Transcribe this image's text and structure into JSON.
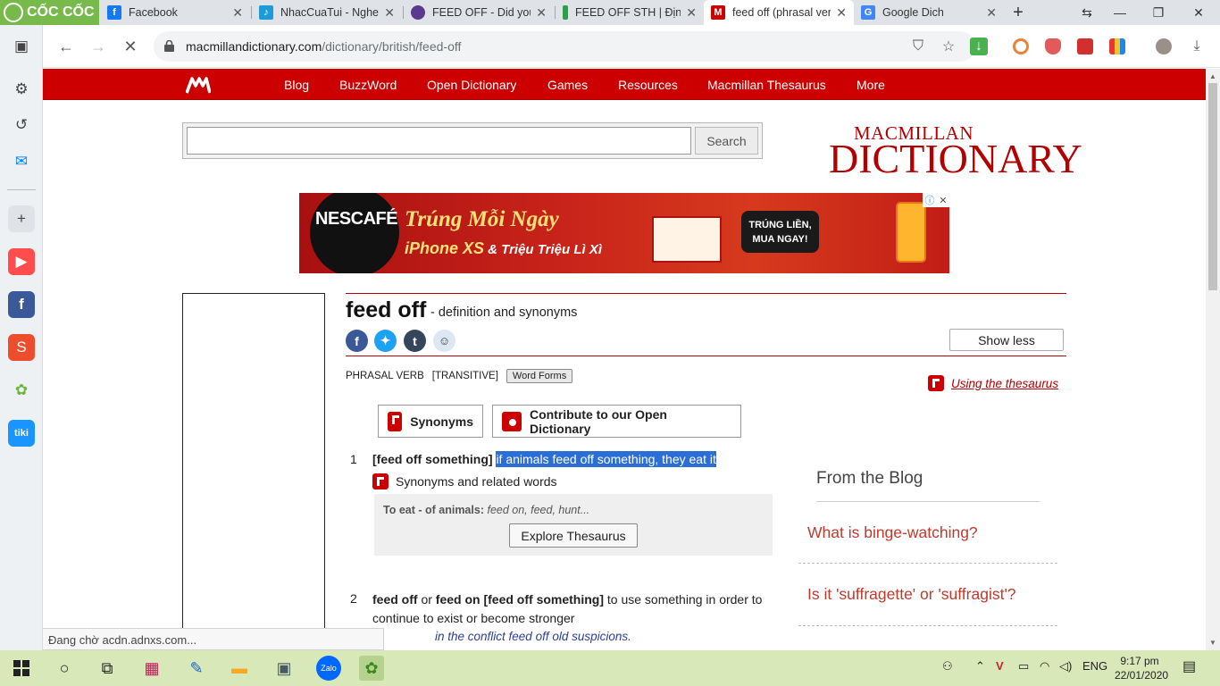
{
  "browser": {
    "brand": "CỐC CỐC",
    "tabs": [
      {
        "title": "Facebook",
        "icon": "facebook-icon",
        "color": "#1877f2",
        "glyph": "f"
      },
      {
        "title": "NhacCuaTui - Nghe n",
        "icon": "nhaccuatui-icon",
        "color": "#1e9bd7",
        "glyph": "♪"
      },
      {
        "title": "FEED OFF - Did you s",
        "icon": "dictionary-icon",
        "color": "#5b3a8e",
        "glyph": "●"
      },
      {
        "title": "FEED OFF STH | Định",
        "icon": "document-icon",
        "color": "#2d9e4d",
        "glyph": "▌"
      },
      {
        "title": "feed off (phrasal verb",
        "icon": "macmillan-icon",
        "color": "#cc0000",
        "glyph": "M"
      },
      {
        "title": "Google Dich",
        "icon": "google-translate-icon",
        "color": "#4285f4",
        "glyph": "G"
      }
    ],
    "url_domain": "macmillandictionary.com",
    "url_path": "/dictionary/british/feed-off",
    "status": "Đang chờ acdn.adnxs.com..."
  },
  "site": {
    "nav": [
      "Blog",
      "BuzzWord",
      "Open Dictionary",
      "Games",
      "Resources",
      "Macmillan Thesaurus",
      "More"
    ],
    "search_button": "Search",
    "search_placeholder": "",
    "logo_small": "MACMILLAN",
    "logo_big": "DICTIONARY"
  },
  "ad": {
    "brand": "NESCAFÉ",
    "headline": "Trúng Mỗi Ngày",
    "sub_strong": "iPhone XS",
    "sub_rest": " & Triệu Triệu Lì Xì",
    "cta_line1": "TRÚNG LIỀN,",
    "cta_line2": "MUA NGAY!"
  },
  "entry": {
    "headword": "feed off",
    "headword_suffix": "- definition and synonyms",
    "show_less": "Show less",
    "pos": "PHRASAL VERB",
    "grammar": "[TRANSITIVE]",
    "word_forms": "Word Forms",
    "thesaurus_link": "Using the thesaurus",
    "synonyms_button": "Synonyms",
    "contribute_button": "Contribute to our Open Dictionary",
    "sense1": {
      "num": "1",
      "gram": "[feed off something]",
      "def": "if animals feed off something, they eat it",
      "related_label": "Synonyms and related words",
      "syn_label": "To eat - of animals:",
      "syn_words": "feed on, feed, hunt...",
      "explore": "Explore Thesaurus"
    },
    "sense2": {
      "num": "2",
      "w1": "feed off",
      "or": " or ",
      "w2": "feed on",
      "gram": " [feed off something]",
      "def": " to use something in order to continue to exist or become stronger",
      "example": "in the conflict feed off old suspicions."
    }
  },
  "blog": {
    "title": "From the Blog",
    "posts": [
      "What is binge-watching?",
      "Is it 'suffragette' or 'suffragist'?"
    ]
  },
  "taskbar": {
    "language": "ENG",
    "time": "9:17 pm",
    "date": "22/01/2020"
  }
}
